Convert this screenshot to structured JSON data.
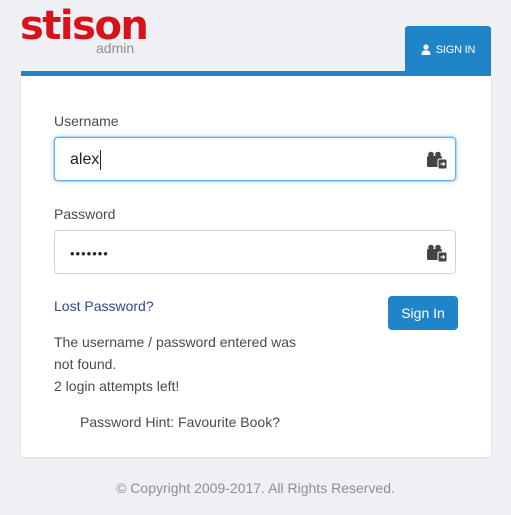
{
  "brand": {
    "name": "stison",
    "subtitle": "admin",
    "color": "#d7121b"
  },
  "tab": {
    "label": "SIGN IN",
    "icon": "user-icon"
  },
  "form": {
    "username": {
      "label": "Username",
      "value": "alex",
      "icon": "key-card-icon"
    },
    "password": {
      "label": "Password",
      "masked_value": "•••••••",
      "icon": "key-card-icon"
    },
    "lost_password_label": "Lost Password?",
    "submit_label": "Sign In"
  },
  "messages": {
    "error_line_1": "The username / password entered was",
    "error_line_2": "not found.",
    "attempts": "2 login attempts left!",
    "hint": "Password Hint: Favourite Book?"
  },
  "footer": {
    "copyright": "© Copyright 2009-2017. All Rights Reserved."
  },
  "colors": {
    "accent": "#1f84c8",
    "link": "#2c4a87",
    "background": "#eef0f3"
  }
}
